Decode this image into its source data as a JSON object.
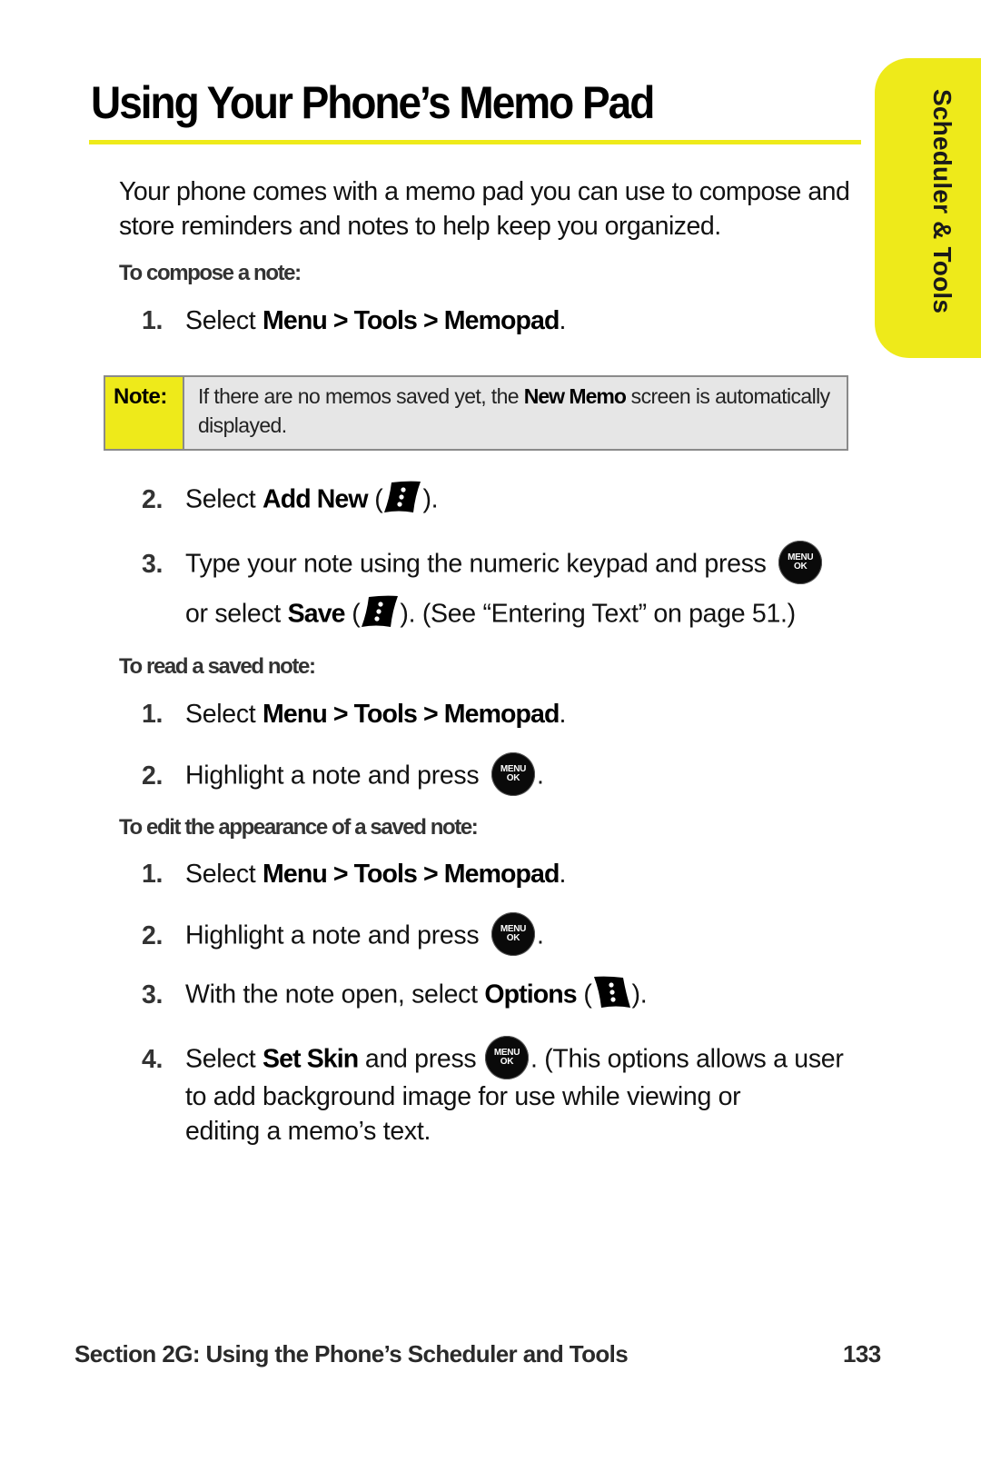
{
  "page": {
    "title": "Using Your Phone’s Memo Pad",
    "side_tab": "Scheduler & Tools",
    "intro": "Your phone comes with a memo pad you can use to compose and store reminders and notes to help keep you organized.",
    "accent_color": "#eeea1a"
  },
  "compose": {
    "heading": "To compose a note:",
    "step1": {
      "num": "1.",
      "pre": "Select ",
      "path": [
        "Menu",
        "Tools",
        "Memopad"
      ],
      "sep": " > ",
      "post": "."
    },
    "note": {
      "label": "Note:",
      "text_pre": "If there are no memos saved yet, the ",
      "text_bold": "New Memo",
      "text_post": " screen is automatically displayed."
    },
    "step2": {
      "num": "2.",
      "pre": "Select ",
      "bold": "Add New",
      "open": " (",
      "icon": "left-softkey-icon",
      "close": ")."
    },
    "step3": {
      "num": "3.",
      "line1": "Type your note using the numeric keypad and press",
      "button_icon": "menu-ok-button-icon",
      "line2_pre": "or select ",
      "line2_bold": "Save",
      "line2_open": " (",
      "line2_icon": "left-softkey-icon",
      "line2_post": "). (See “Entering Text” on page 51.)"
    }
  },
  "read": {
    "heading": "To read a saved note:",
    "step1": {
      "num": "1.",
      "pre": "Select ",
      "b1": "Menu",
      "b2": "Tools",
      "b3": "Memopad",
      "sep": " > ",
      "post": "."
    },
    "step2": {
      "num": "2.",
      "text": "Highlight a note and press",
      "post": "."
    }
  },
  "edit": {
    "heading": "To edit the appearance of a saved note:",
    "step1": {
      "num": "1.",
      "pre": "Select ",
      "b1": "Menu",
      "b2": "Tools",
      "b3": "Memopad",
      "sep": " > ",
      "post": "."
    },
    "step2": {
      "num": "2.",
      "text": "Highlight a note and press",
      "post": "."
    },
    "step3": {
      "num": "3.",
      "pre": "With the note open, select ",
      "bold": "Options",
      "open": " (",
      "icon": "right-softkey-icon",
      "close": ")."
    },
    "step4": {
      "num": "4.",
      "pre": "Select ",
      "bold": "Set Skin",
      "mid": " and press ",
      "post": ". (This options allows a user",
      "line2": "to add background image for use while viewing or",
      "line3": "editing a memo’s text."
    }
  },
  "menu_ok": {
    "top": "MENU",
    "bottom": "OK"
  },
  "footer": {
    "section": "Section 2G: Using the Phone’s Scheduler and Tools",
    "page_number": "133"
  }
}
